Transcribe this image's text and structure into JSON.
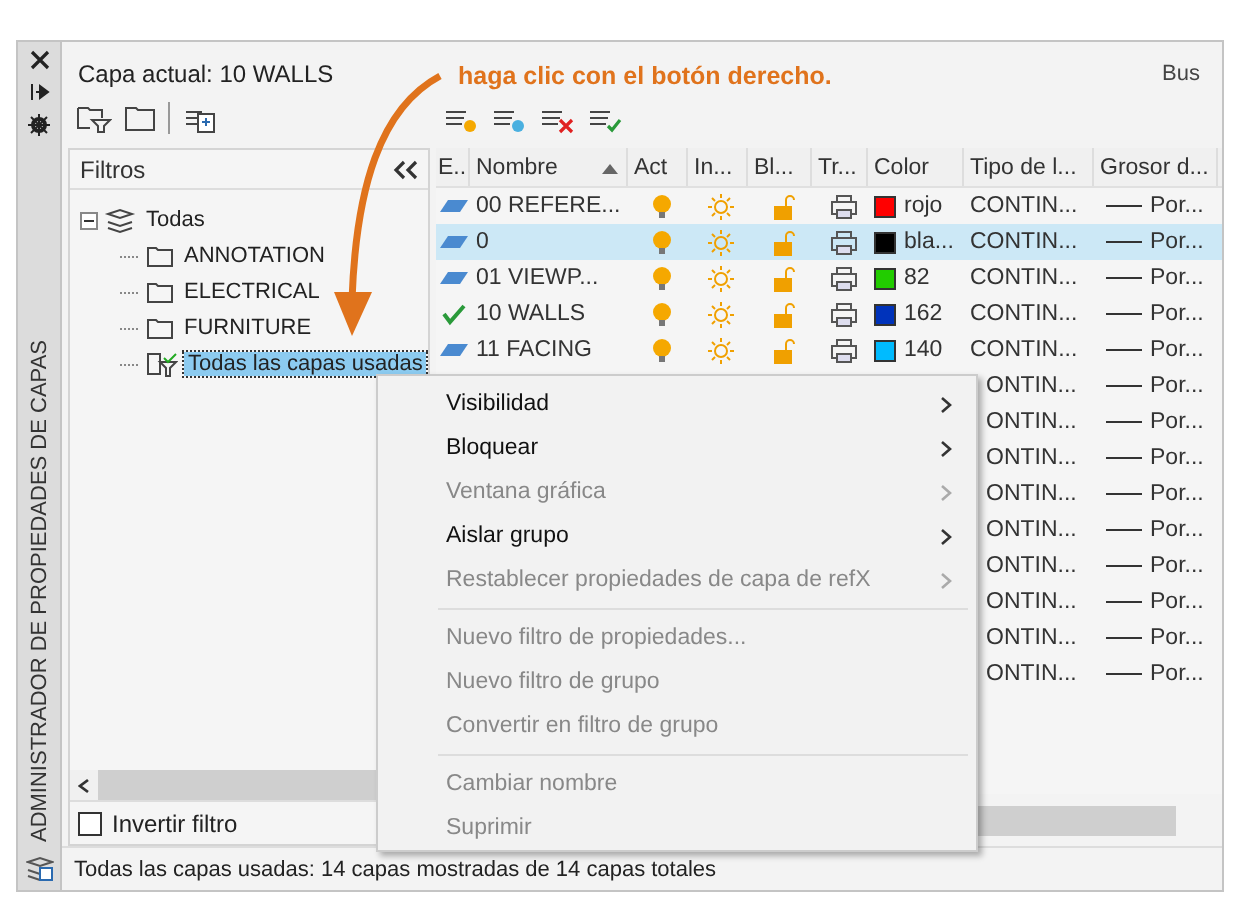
{
  "sidebar": {
    "title": "ADMINISTRADOR DE PROPIEDADES DE CAPAS"
  },
  "current_layer": "Capa actual: 10 WALLS",
  "search": {
    "placeholder": "Bus"
  },
  "annotation": "haga clic con el botón derecho.",
  "filters": {
    "title": "Filtros",
    "tree": [
      {
        "label": "Todas",
        "kind": "all",
        "expanded": true,
        "selected": false,
        "children": [
          {
            "label": "ANNOTATION",
            "kind": "folder",
            "selected": false
          },
          {
            "label": "ELECTRICAL",
            "kind": "folder",
            "selected": false
          },
          {
            "label": "FURNITURE",
            "kind": "folder",
            "selected": false
          },
          {
            "label": "Todas las capas usadas",
            "kind": "filter",
            "selected": true
          }
        ]
      }
    ]
  },
  "invert_filter": {
    "label": "Invertir filtro",
    "checked": false
  },
  "table": {
    "columns": [
      {
        "label": "E..",
        "sorted": false
      },
      {
        "label": "Nombre",
        "sorted": true
      },
      {
        "label": "Act",
        "sorted": false
      },
      {
        "label": "In...",
        "sorted": false
      },
      {
        "label": "Bl...",
        "sorted": false
      },
      {
        "label": "Tr...",
        "sorted": false
      },
      {
        "label": "Color",
        "sorted": false
      },
      {
        "label": "Tipo de l...",
        "sorted": false
      },
      {
        "label": "Grosor d...",
        "sorted": false
      }
    ],
    "rows": [
      {
        "kind": "layer",
        "current": false,
        "name": "00 REFERE...",
        "color": "#ff0000",
        "color_name": "rojo",
        "linetype": "CONTIN...",
        "lineweight": "Por...",
        "selected": false
      },
      {
        "kind": "layer",
        "current": false,
        "name": "0",
        "color": "#000000",
        "color_name": "bla...",
        "linetype": "CONTIN...",
        "lineweight": "Por...",
        "selected": true
      },
      {
        "kind": "layer",
        "current": false,
        "name": "01 VIEWP...",
        "color": "#22cc00",
        "color_name": "82",
        "linetype": "CONTIN...",
        "lineweight": "Por...",
        "selected": false
      },
      {
        "kind": "layer",
        "current": true,
        "name": "10 WALLS",
        "color": "#0033bb",
        "color_name": "162",
        "linetype": "CONTIN...",
        "lineweight": "Por...",
        "selected": false
      },
      {
        "kind": "layer",
        "current": false,
        "name": "11 FACING",
        "color": "#00bbff",
        "color_name": "140",
        "linetype": "CONTIN...",
        "lineweight": "Por...",
        "selected": false
      },
      {
        "kind": "covered",
        "linetype": "ONTIN...",
        "lineweight": "Por..."
      },
      {
        "kind": "covered",
        "linetype": "ONTIN...",
        "lineweight": "Por..."
      },
      {
        "kind": "covered",
        "linetype": "ONTIN...",
        "lineweight": "Por..."
      },
      {
        "kind": "covered",
        "linetype": "ONTIN...",
        "lineweight": "Por..."
      },
      {
        "kind": "covered",
        "linetype": "ONTIN...",
        "lineweight": "Por..."
      },
      {
        "kind": "covered",
        "linetype": "ONTIN...",
        "lineweight": "Por..."
      },
      {
        "kind": "covered",
        "linetype": "ONTIN...",
        "lineweight": "Por..."
      },
      {
        "kind": "covered",
        "linetype": "ONTIN...",
        "lineweight": "Por..."
      },
      {
        "kind": "covered",
        "linetype": "ONTIN...",
        "lineweight": "Por..."
      }
    ]
  },
  "context_menu": [
    {
      "kind": "item",
      "label": "Visibilidad",
      "disabled": false,
      "submenu": true
    },
    {
      "kind": "item",
      "label": "Bloquear",
      "disabled": false,
      "submenu": true
    },
    {
      "kind": "item",
      "label": "Ventana gráfica",
      "disabled": true,
      "submenu": true
    },
    {
      "kind": "item",
      "label": "Aislar grupo",
      "disabled": false,
      "submenu": true
    },
    {
      "kind": "item",
      "label": "Restablecer propiedades de capa de refX",
      "disabled": true,
      "submenu": true
    },
    {
      "kind": "separator"
    },
    {
      "kind": "item",
      "label": "Nuevo filtro de propiedades...",
      "disabled": true,
      "submenu": false
    },
    {
      "kind": "item",
      "label": "Nuevo filtro de grupo",
      "disabled": true,
      "submenu": false
    },
    {
      "kind": "item",
      "label": "Convertir en filtro de grupo",
      "disabled": true,
      "submenu": false
    },
    {
      "kind": "separator"
    },
    {
      "kind": "item",
      "label": "Cambiar nombre",
      "disabled": true,
      "submenu": false
    },
    {
      "kind": "item",
      "label": "Suprimir",
      "disabled": true,
      "submenu": false
    }
  ],
  "status_bar": "Todas las capas usadas: 14 capas mostradas de 14 capas totales"
}
